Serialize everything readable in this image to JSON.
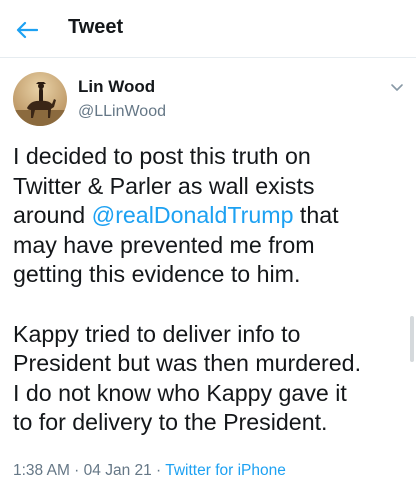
{
  "header": {
    "title": "Tweet"
  },
  "author": {
    "name": "Lin Wood",
    "handle": "@LLinWood"
  },
  "tweet": {
    "p1": {
      "l1": "I decided to post this truth on",
      "l2": "Twitter & Parler as wall exists",
      "l3_pre": "around ",
      "l3_mention": "@realDonaldTrump",
      "l3_post": " that",
      "l4": "may have prevented me from",
      "l5": "getting this evidence to him."
    },
    "p2": {
      "l1": "Kappy tried to deliver info to",
      "l2": "President but was then murdered.",
      "l3": "I do not know who Kappy gave it",
      "l4": "to for delivery to the President."
    }
  },
  "meta": {
    "time": "1:38 AM",
    "sep1": " · ",
    "date": "04 Jan 21",
    "sep2": " · ",
    "source": "Twitter for iPhone"
  },
  "colors": {
    "accent": "#1da1f2",
    "secondary": "#657786"
  }
}
